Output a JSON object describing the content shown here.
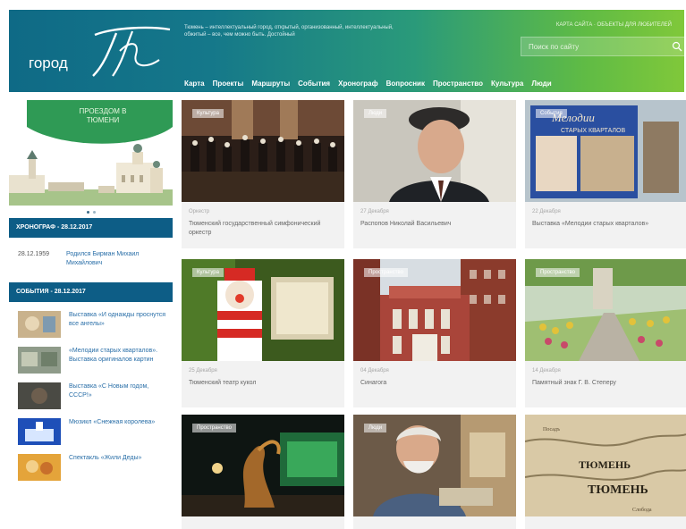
{
  "header": {
    "logo_word": "город",
    "tagline": "Тюмень – интеллектуальный город, открытый, организованный, интеллектуальный, обжитый – все, чем можно быть. Достойный",
    "top_links": "КАРТА САЙТА · ОБЪЕКТЫ ДЛЯ ЛЮБИТЕЛЕЙ",
    "search_placeholder": "Поиск по сайту",
    "nav": [
      "Карта",
      "Проекты",
      "Маршруты",
      "События",
      "Хронограф",
      "Вопросник",
      "Пространство",
      "Культура",
      "Люди"
    ]
  },
  "banner": {
    "text": "ПРОЕЗДОМ В ТЮМЕНИ"
  },
  "chronograph": {
    "heading": "ХРОНОГРАФ - 28.12.2017",
    "date": "28.12.1959",
    "text": "Родился Бирман Михаил Михайлович"
  },
  "events": {
    "heading": "СОБЫТИЯ - 28.12.2017",
    "items": [
      "Выставка «И однажды проснутся все ангелы»",
      "«Мелодии старых кварталов». Выставка оригиналов картин",
      "Выставка «С Новым годом, СССР!»",
      "Мюзикл «Снежная королева»",
      "Спектакль «Жили Деды»"
    ]
  },
  "cards": [
    {
      "tag": "Культура",
      "date": "Оркестр",
      "title": "Тюменский государственный симфонический оркестр"
    },
    {
      "tag": "Люди",
      "date": "27 Декабря",
      "title": "Распопов Николай Васильевич"
    },
    {
      "tag": "События",
      "date": "22 Декабря",
      "title": "Выставка «Мелодии старых кварталов»"
    },
    {
      "tag": "Культура",
      "date": "25 Декабря",
      "title": "Тюменский театр кукол"
    },
    {
      "tag": "Пространство",
      "date": "04 Декабря",
      "title": "Синагога"
    },
    {
      "tag": "Пространство",
      "date": "14 Декабря",
      "title": "Памятный знак Г. В. Степеру"
    },
    {
      "tag": "Пространство",
      "date": "",
      "title": ""
    },
    {
      "tag": "Люди",
      "date": "",
      "title": ""
    },
    {
      "tag": "",
      "date": "",
      "title": ""
    }
  ],
  "colors": {
    "header_start": "#0f6a86",
    "header_end": "#80c83a",
    "section_head": "#0d5d86",
    "link": "#2a6fa8"
  }
}
